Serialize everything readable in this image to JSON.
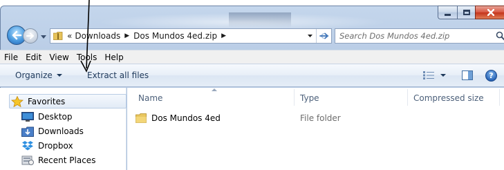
{
  "window": {
    "caption_buttons": [
      "minimize",
      "maximize",
      "close"
    ]
  },
  "address": {
    "overflow": "«",
    "crumbs": [
      "Downloads",
      "Dos Mundos 4ed.zip"
    ]
  },
  "search": {
    "placeholder": "Search Dos Mundos 4ed.zip"
  },
  "menu": {
    "items": [
      "File",
      "Edit",
      "View",
      "Tools",
      "Help"
    ]
  },
  "commands": {
    "organize": "Organize",
    "extract_all": "Extract all files"
  },
  "nav_pane": {
    "favorites": "Favorites",
    "items": [
      {
        "label": "Desktop",
        "icon": "desktop-icon"
      },
      {
        "label": "Downloads",
        "icon": "downloads-icon"
      },
      {
        "label": "Dropbox",
        "icon": "dropbox-icon"
      },
      {
        "label": "Recent Places",
        "icon": "recent-places-icon"
      }
    ]
  },
  "file_list": {
    "columns": [
      "Name",
      "Type",
      "Compressed size"
    ],
    "rows": [
      {
        "name": "Dos Mundos 4ed",
        "type": "File folder",
        "compressed_size": ""
      }
    ]
  },
  "colors": {
    "frame": "#b5c9e3",
    "command_text": "#1e395b",
    "close_button": "#c4331c"
  }
}
